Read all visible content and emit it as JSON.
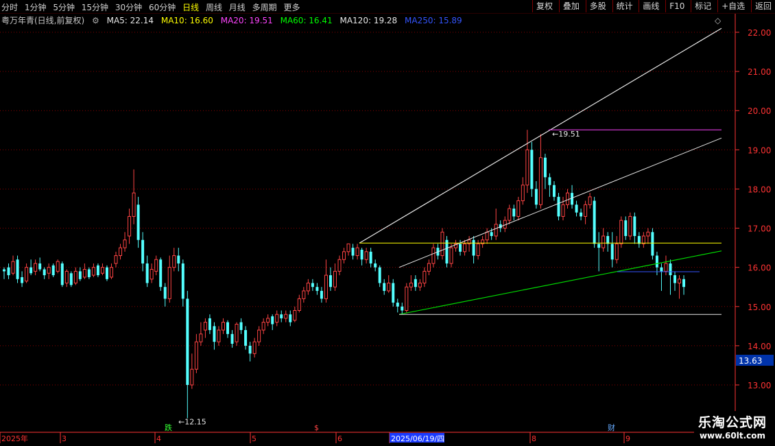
{
  "toolbar": {
    "left_items": [
      "分时",
      "1分钟",
      "5分钟",
      "15分钟",
      "30分钟",
      "60分钟",
      "日线",
      "周线",
      "月线",
      "多周期",
      "更多"
    ],
    "active": "日线",
    "right_items": [
      "复权",
      "叠加",
      "多股",
      "统计",
      "画线",
      "F10",
      "标记",
      "+自选",
      "返回"
    ]
  },
  "info": {
    "stock_label": "粤万年青(日线,前复权)",
    "ma": [
      {
        "text": "MA5: 22.14",
        "color": "#e8e8e8"
      },
      {
        "text": "MA10: 16.60",
        "color": "#ffff00"
      },
      {
        "text": "MA20: 19.51",
        "color": "#ff44ff"
      },
      {
        "text": "MA60: 16.41",
        "color": "#00ff00"
      },
      {
        "text": "MA120: 19.28",
        "color": "#e8e8e8"
      },
      {
        "text": "MA250: 15.89",
        "color": "#3355ff"
      }
    ]
  },
  "colors": {
    "up": "#ff4444",
    "down": "#54ffff",
    "grid": "#8a0000",
    "axis": "#ff3333"
  },
  "chart_data": {
    "type": "candlestick",
    "y_ticks": [
      "22.00",
      "21.00",
      "20.00",
      "19.00",
      "18.00",
      "17.00",
      "16.00",
      "15.00",
      "14.00",
      "13.00"
    ],
    "ylim": [
      12.2,
      22.4
    ],
    "current_price": "13.63",
    "x_labels": [
      "2025年",
      "3",
      "4",
      "5",
      "6",
      "2025/06/19/四",
      "8",
      "9"
    ],
    "annotations": {
      "high": "19.51",
      "low": "12.15"
    },
    "markers": [
      "跌",
      "$",
      "财"
    ],
    "candles": [
      [
        15.95,
        15.9,
        16.0,
        15.7
      ],
      [
        16.0,
        15.8,
        16.1,
        15.7
      ],
      [
        15.85,
        16.15,
        16.3,
        15.8
      ],
      [
        16.2,
        15.7,
        16.3,
        15.6
      ],
      [
        15.75,
        15.6,
        15.9,
        15.5
      ],
      [
        15.65,
        16.0,
        16.1,
        15.6
      ],
      [
        16.0,
        15.85,
        16.2,
        15.8
      ],
      [
        15.9,
        16.1,
        16.2,
        15.8
      ],
      [
        16.1,
        15.95,
        16.25,
        15.9
      ],
      [
        15.95,
        15.8,
        16.0,
        15.7
      ],
      [
        15.85,
        16.0,
        16.1,
        15.7
      ],
      [
        16.05,
        15.8,
        16.1,
        15.75
      ],
      [
        15.9,
        16.15,
        16.2,
        15.85
      ],
      [
        16.1,
        15.55,
        16.15,
        15.5
      ],
      [
        15.6,
        15.9,
        15.95,
        15.5
      ],
      [
        15.85,
        15.55,
        15.9,
        15.5
      ],
      [
        15.6,
        15.9,
        16.0,
        15.55
      ],
      [
        15.9,
        15.7,
        16.0,
        15.65
      ],
      [
        15.75,
        15.95,
        16.1,
        15.7
      ],
      [
        15.95,
        15.75,
        16.0,
        15.7
      ],
      [
        15.8,
        16.0,
        16.1,
        15.75
      ],
      [
        16.05,
        15.8,
        16.1,
        15.75
      ],
      [
        15.85,
        16.0,
        16.1,
        15.8
      ],
      [
        16.0,
        15.7,
        16.05,
        15.65
      ],
      [
        15.75,
        16.0,
        16.1,
        15.7
      ],
      [
        16.1,
        16.3,
        16.4,
        16.0
      ],
      [
        16.3,
        16.5,
        16.6,
        16.2
      ],
      [
        16.5,
        16.7,
        16.9,
        16.4
      ],
      [
        16.8,
        17.3,
        17.5,
        16.6
      ],
      [
        17.3,
        17.9,
        18.5,
        17.1
      ],
      [
        17.6,
        16.7,
        17.8,
        16.5
      ],
      [
        16.7,
        16.1,
        16.9,
        15.9
      ],
      [
        16.1,
        15.6,
        16.3,
        15.5
      ],
      [
        15.7,
        15.95,
        16.1,
        15.6
      ],
      [
        15.9,
        16.2,
        16.3,
        15.8
      ],
      [
        16.2,
        15.5,
        16.25,
        15.4
      ],
      [
        15.5,
        15.2,
        15.6,
        15.0
      ],
      [
        15.2,
        16.0,
        16.3,
        15.1
      ],
      [
        16.0,
        16.3,
        16.5,
        15.9
      ],
      [
        16.3,
        16.1,
        16.5,
        15.9
      ],
      [
        16.1,
        15.2,
        16.2,
        15.0
      ],
      [
        15.2,
        13.0,
        15.4,
        12.15
      ],
      [
        13.0,
        13.4,
        13.8,
        12.9
      ],
      [
        13.4,
        14.1,
        14.3,
        13.3
      ],
      [
        14.1,
        14.3,
        14.6,
        14.0
      ],
      [
        14.4,
        14.6,
        14.7,
        14.2
      ],
      [
        14.7,
        14.4,
        14.8,
        14.3
      ],
      [
        14.5,
        14.1,
        14.6,
        13.9
      ],
      [
        14.1,
        14.4,
        14.5,
        14.0
      ],
      [
        14.4,
        14.6,
        14.7,
        14.3
      ],
      [
        14.6,
        14.3,
        14.65,
        14.2
      ],
      [
        14.3,
        14.05,
        14.4,
        13.95
      ],
      [
        14.1,
        14.55,
        14.6,
        14.0
      ],
      [
        14.6,
        14.4,
        14.7,
        14.3
      ],
      [
        14.4,
        14.0,
        14.5,
        13.9
      ],
      [
        14.0,
        13.8,
        14.1,
        13.6
      ],
      [
        13.8,
        14.1,
        14.2,
        13.7
      ],
      [
        14.1,
        14.4,
        14.5,
        14.0
      ],
      [
        14.4,
        14.6,
        14.7,
        14.3
      ],
      [
        14.6,
        14.7,
        14.8,
        14.5
      ],
      [
        14.75,
        14.55,
        14.8,
        14.4
      ],
      [
        14.6,
        14.8,
        14.9,
        14.5
      ],
      [
        14.8,
        14.7,
        14.9,
        14.6
      ],
      [
        14.7,
        14.8,
        14.9,
        14.6
      ],
      [
        14.8,
        14.6,
        14.9,
        14.5
      ],
      [
        14.65,
        14.9,
        15.0,
        14.6
      ],
      [
        14.9,
        15.2,
        15.3,
        14.85
      ],
      [
        15.2,
        15.4,
        15.5,
        15.1
      ],
      [
        15.4,
        15.6,
        15.7,
        15.3
      ],
      [
        15.6,
        15.5,
        15.7,
        15.4
      ],
      [
        15.5,
        15.4,
        15.6,
        15.3
      ],
      [
        15.4,
        15.2,
        15.5,
        15.1
      ],
      [
        15.2,
        15.8,
        16.2,
        15.1
      ],
      [
        15.8,
        15.5,
        16.0,
        15.4
      ],
      [
        15.5,
        15.9,
        16.1,
        15.4
      ],
      [
        15.9,
        16.2,
        16.3,
        15.8
      ],
      [
        16.2,
        16.4,
        16.5,
        16.1
      ],
      [
        16.4,
        16.6,
        16.6,
        16.3
      ],
      [
        16.5,
        16.3,
        16.6,
        16.2
      ],
      [
        16.3,
        16.5,
        16.6,
        16.2
      ],
      [
        16.45,
        16.2,
        16.5,
        16.05
      ],
      [
        16.2,
        16.4,
        16.5,
        16.1
      ],
      [
        16.4,
        16.1,
        16.5,
        16.0
      ],
      [
        16.1,
        16.0,
        16.2,
        15.9
      ],
      [
        16.0,
        15.6,
        16.05,
        15.5
      ],
      [
        15.6,
        15.4,
        15.7,
        15.3
      ],
      [
        15.4,
        15.6,
        15.8,
        15.35
      ],
      [
        15.6,
        15.1,
        15.7,
        15.0
      ],
      [
        15.1,
        15.0,
        15.2,
        14.85
      ],
      [
        15.0,
        14.9,
        15.1,
        14.8
      ],
      [
        14.9,
        15.5,
        15.6,
        14.85
      ],
      [
        15.5,
        15.6,
        15.8,
        15.4
      ],
      [
        15.7,
        15.5,
        15.8,
        15.4
      ],
      [
        15.5,
        15.6,
        15.7,
        15.4
      ],
      [
        15.6,
        15.9,
        16.0,
        15.5
      ],
      [
        15.9,
        16.1,
        16.2,
        15.8
      ],
      [
        16.1,
        16.5,
        16.6,
        16.0
      ],
      [
        16.5,
        16.3,
        16.6,
        16.2
      ],
      [
        16.3,
        16.9,
        17.0,
        16.2
      ],
      [
        16.7,
        16.1,
        16.8,
        16.0
      ],
      [
        16.1,
        16.5,
        16.6,
        16.0
      ],
      [
        16.5,
        16.6,
        16.7,
        16.4
      ],
      [
        16.6,
        16.4,
        16.7,
        16.3
      ],
      [
        16.4,
        16.6,
        16.7,
        16.3
      ],
      [
        16.6,
        16.7,
        16.8,
        16.4
      ],
      [
        16.7,
        16.3,
        16.8,
        16.1
      ],
      [
        16.3,
        16.6,
        16.7,
        16.2
      ],
      [
        16.6,
        16.7,
        16.8,
        16.5
      ],
      [
        16.7,
        16.9,
        17.0,
        16.6
      ],
      [
        16.9,
        16.8,
        17.0,
        16.7
      ],
      [
        16.8,
        17.1,
        17.5,
        16.7
      ],
      [
        17.1,
        17.0,
        17.2,
        16.9
      ],
      [
        17.0,
        17.2,
        17.3,
        16.9
      ],
      [
        17.2,
        17.5,
        17.6,
        17.1
      ],
      [
        17.5,
        17.3,
        17.6,
        17.2
      ],
      [
        17.3,
        17.7,
        17.8,
        17.2
      ],
      [
        17.7,
        18.1,
        18.3,
        17.6
      ],
      [
        18.1,
        19.0,
        19.51,
        17.9
      ],
      [
        19.0,
        18.0,
        19.2,
        17.8
      ],
      [
        18.0,
        17.6,
        18.2,
        17.5
      ],
      [
        17.6,
        18.8,
        19.4,
        17.5
      ],
      [
        18.8,
        18.3,
        18.9,
        18.0
      ],
      [
        18.3,
        18.1,
        18.4,
        17.8
      ],
      [
        18.1,
        17.8,
        18.2,
        17.7
      ],
      [
        17.8,
        17.3,
        17.9,
        17.2
      ],
      [
        17.3,
        17.6,
        17.8,
        17.2
      ],
      [
        17.6,
        17.9,
        18.0,
        17.5
      ],
      [
        17.9,
        17.6,
        18.1,
        17.5
      ],
      [
        17.6,
        17.4,
        17.7,
        17.3
      ],
      [
        17.4,
        17.3,
        17.5,
        17.2
      ],
      [
        17.3,
        17.6,
        17.7,
        17.1
      ],
      [
        17.6,
        17.8,
        17.9,
        17.5
      ],
      [
        17.7,
        16.6,
        17.8,
        16.5
      ],
      [
        16.6,
        16.5,
        16.9,
        15.9
      ],
      [
        16.5,
        16.8,
        17.0,
        16.4
      ],
      [
        16.8,
        16.6,
        16.9,
        16.4
      ],
      [
        16.6,
        16.2,
        16.9,
        16.0
      ],
      [
        16.2,
        16.6,
        16.8,
        16.1
      ],
      [
        16.6,
        17.2,
        17.3,
        16.5
      ],
      [
        17.2,
        16.8,
        17.3,
        16.7
      ],
      [
        16.8,
        17.3,
        17.4,
        16.7
      ],
      [
        17.3,
        16.8,
        17.4,
        16.6
      ],
      [
        16.8,
        16.6,
        16.9,
        16.5
      ],
      [
        16.6,
        16.8,
        16.9,
        16.5
      ],
      [
        16.8,
        16.9,
        17.0,
        16.6
      ],
      [
        16.9,
        16.3,
        17.0,
        16.2
      ],
      [
        16.3,
        16.0,
        16.4,
        15.8
      ],
      [
        16.0,
        15.9,
        16.1,
        15.4
      ],
      [
        15.9,
        16.1,
        16.3,
        15.8
      ],
      [
        16.1,
        15.8,
        16.2,
        15.3
      ],
      [
        15.8,
        15.6,
        15.9,
        15.4
      ],
      [
        15.6,
        15.7,
        15.8,
        15.2
      ],
      [
        15.7,
        15.5,
        15.8,
        15.3
      ]
    ]
  },
  "watermark": {
    "line1": "乐淘公式网",
    "line2": "www.60lt.com"
  }
}
